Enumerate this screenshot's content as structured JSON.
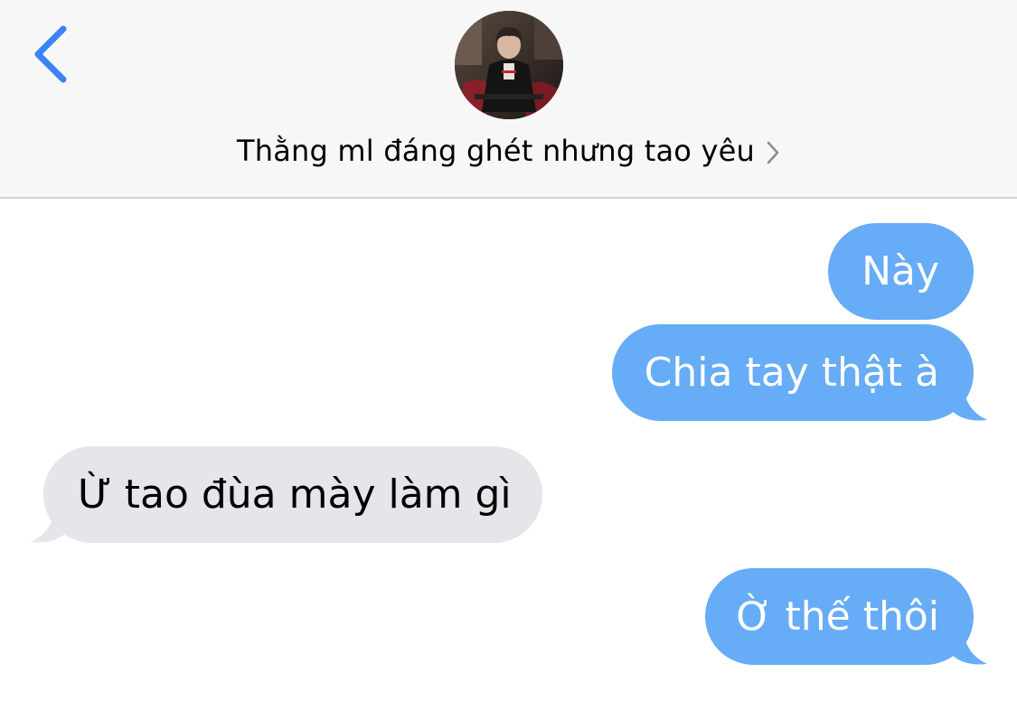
{
  "header": {
    "contact_name": "Thằng ml đáng ghét nhưng tao yêu",
    "back_icon": "chevron-left-icon",
    "disclosure_icon": "chevron-right-icon"
  },
  "colors": {
    "accent": "#3b82f6",
    "outgoing_bubble": "#66acf6",
    "incoming_bubble": "#e5e5ea",
    "header_background": "#f7f7f7"
  },
  "messages": [
    {
      "direction": "outgoing",
      "text": "Này",
      "has_tail": false
    },
    {
      "direction": "outgoing",
      "text": "Chia tay thật à",
      "has_tail": true
    },
    {
      "direction": "incoming",
      "text": "Ừ tao đùa mày làm gì",
      "has_tail": true
    },
    {
      "direction": "outgoing",
      "text": "Ờ thế thôi",
      "has_tail": true
    }
  ]
}
